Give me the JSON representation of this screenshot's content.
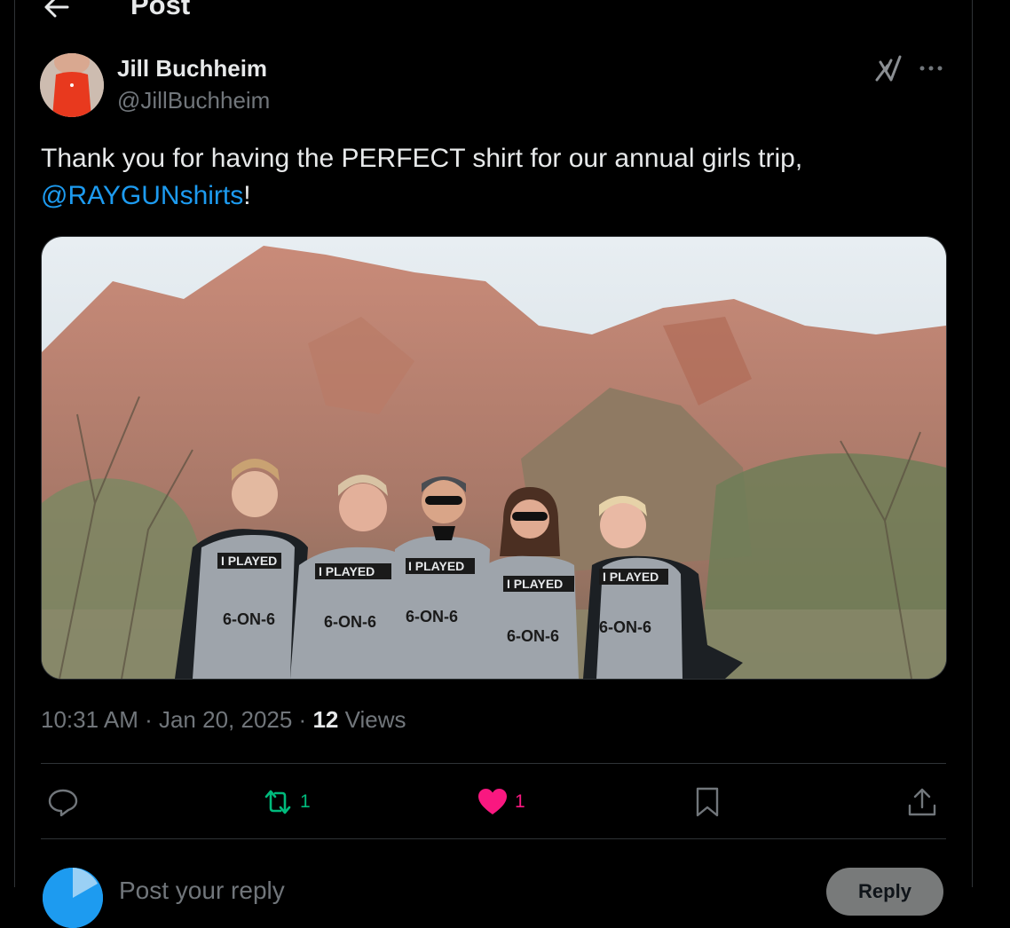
{
  "header": {
    "title": "Post"
  },
  "post": {
    "author_name": "Jill Buchheim",
    "author_handle": "@JillBuchheim",
    "text_before": "Thank you for having the PERFECT shirt for our annual girls trip,",
    "mention": "@RAYGUNshirts",
    "text_after": "!",
    "time": "10:31 AM",
    "date": "Jan 20, 2025",
    "views_count": "12",
    "views_label": "Views",
    "photo": {
      "subject": "five women in matching grey shirts in front of red rock cliffs",
      "shirt_line1": "I PLAYED",
      "shirt_line2": "6-ON-6"
    }
  },
  "actions": {
    "reply_icon": "speech-bubble-icon",
    "retweet_icon": "repost-icon",
    "retweet_count": "1",
    "like_icon": "heart-icon",
    "like_count": "1",
    "bookmark_icon": "bookmark-icon",
    "share_icon": "share-icon"
  },
  "reply_bar": {
    "placeholder": "Post your reply",
    "button": "Reply"
  },
  "colors": {
    "background": "#000000",
    "accent": "#1d9bf0",
    "retweet": "#00ba7c",
    "like": "#f91880",
    "muted": "#71767b"
  }
}
